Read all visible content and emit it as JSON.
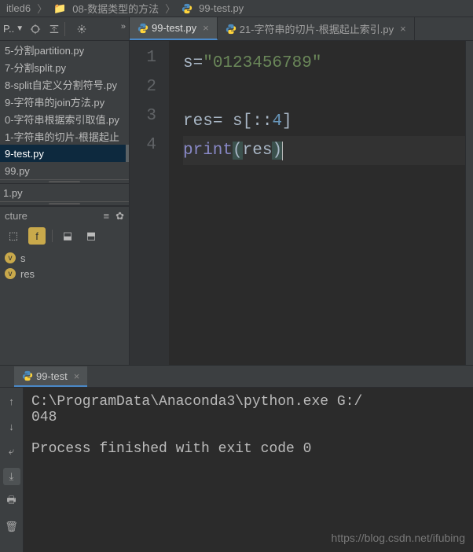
{
  "breadcrumb": {
    "project": "itled6",
    "folder": "08-数据类型的方法",
    "file": "99-test.py"
  },
  "toolbar": {
    "project_selector": "P..",
    "overflow": "»"
  },
  "tabs": [
    {
      "label": "99-test.py",
      "active": true
    },
    {
      "label": "21-字符串的切片-根据起止索引.py",
      "active": false
    }
  ],
  "sidebar": {
    "files": [
      "5-分割partition.py",
      "7-分割split.py",
      "8-split自定义分割符号.py",
      "9-字符串的join方法.py",
      "0-字符串根据索引取值.py",
      "1-字符串的切片-根据起止",
      "9-test.py",
      "99.py"
    ],
    "files2": [
      "1.py"
    ],
    "selected_index": 6,
    "structure_label": "cture",
    "structure_items": [
      "s",
      "res"
    ]
  },
  "editor": {
    "line_numbers": [
      "1",
      "2",
      "3",
      "4"
    ],
    "code": {
      "l1_var": "s",
      "l1_eq": " = ",
      "l1_str": "\"0123456789\"",
      "l3_var": "res",
      "l3_eq": " = s[::",
      "l3_num": "4",
      "l3_end": "]",
      "l4_fn": "print",
      "l4_open": "(",
      "l4_arg": "res",
      "l4_close": ")"
    }
  },
  "console": {
    "tab_label": "99-test",
    "output_line1": "C:\\ProgramData\\Anaconda3\\python.exe G:/",
    "output_line2": "048",
    "output_line3": "",
    "output_line4": "Process finished with exit code 0"
  },
  "watermark": "https://blog.csdn.net/ifubing"
}
